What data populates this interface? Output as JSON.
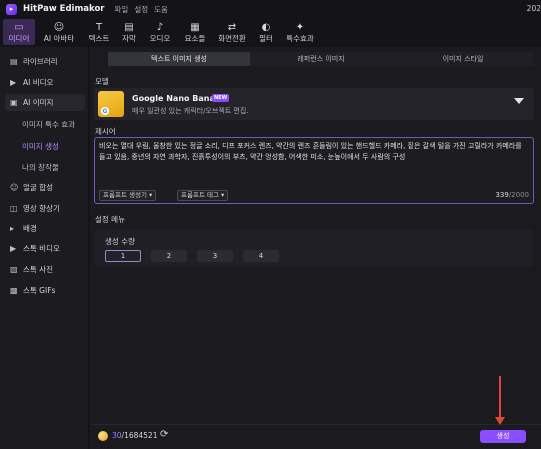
{
  "titlebar": {
    "app_name": "HitPaw Edimakor",
    "menu": [
      "파일",
      "설정",
      "도움"
    ],
    "version": "202"
  },
  "toolbar": [
    {
      "icon": "media-icon",
      "glyph": "▭",
      "label": "미디어",
      "active": true
    },
    {
      "icon": "ai-avatar-icon",
      "glyph": "☺",
      "label": "AI 아바타",
      "active": false
    },
    {
      "icon": "text-icon",
      "glyph": "T",
      "label": "텍스트",
      "active": false
    },
    {
      "icon": "subtitle-icon",
      "glyph": "▤",
      "label": "자막",
      "active": false
    },
    {
      "icon": "audio-icon",
      "glyph": "♪",
      "label": "오디오",
      "active": false
    },
    {
      "icon": "elements-icon",
      "glyph": "▦",
      "label": "요소들",
      "active": false
    },
    {
      "icon": "transition-icon",
      "glyph": "⇄",
      "label": "화면전환",
      "active": false
    },
    {
      "icon": "filter-icon",
      "glyph": "◐",
      "label": "필터",
      "active": false
    },
    {
      "icon": "effects-icon",
      "glyph": "✦",
      "label": "특수효과",
      "active": false
    }
  ],
  "sidebar": {
    "items": [
      {
        "icon": "library-icon",
        "glyph": "▤",
        "label": "라이브러리"
      },
      {
        "icon": "ai-video-icon",
        "glyph": "▶",
        "label": "AI 비디오"
      },
      {
        "icon": "ai-image-icon",
        "glyph": "▣",
        "label": "AI 이미지"
      },
      {
        "icon": "face-swap-icon",
        "glyph": "☺",
        "label": "얼굴 합성"
      },
      {
        "icon": "video-enhance-icon",
        "glyph": "◫",
        "label": "영상 향상기"
      },
      {
        "icon": "background-icon",
        "glyph": "▸",
        "label": "배경"
      },
      {
        "icon": "stock-video-icon",
        "glyph": "▶",
        "label": "스톡 비디오"
      },
      {
        "icon": "stock-photo-icon",
        "glyph": "▨",
        "label": "스톡 사진"
      },
      {
        "icon": "stock-gif-icon",
        "glyph": "▩",
        "label": "스톡 GIFs"
      }
    ],
    "sub_items": [
      "이미지 특수 효과",
      "이미지 생성",
      "나의 창작물"
    ]
  },
  "tabs": [
    "텍스트 이미지 생성",
    "레퍼런스 이미지",
    "이미지 스타일"
  ],
  "model": {
    "section_label": "모델",
    "name": "Google Nano Banana",
    "badge": "NEW",
    "description": "매우 일관성 있는 캐릭터/오브젝트 편집."
  },
  "prompt": {
    "section_label": "제시어",
    "text": "비오는 열대 우림, 울창한 있는 정글 소리, 디프 포커스 렌즈, 약간의 렌즈 흔들림이 있는 핸드헬드 카메라, 짙은 갈색 털을 가진 고릴라가 카메라를 들고 있음, 중년의 자연 과학자, 진흙투성이의 부츠, 약간 엉성함, 어색한 미소, 눈높이에서 두 사람의 구성",
    "generator_button": "프롬프트 생성기",
    "tag_button": "프롬프트 태그",
    "count": "339",
    "max": "/2000"
  },
  "settings": {
    "section_label": "설정 메뉴",
    "count_label": "생성 수량",
    "counts": [
      "1",
      "2",
      "3",
      "4"
    ]
  },
  "footer": {
    "credits_used": "30",
    "credits_total": "/1684521",
    "generate_button": "생성"
  },
  "colors": {
    "accent": "#8a4dff",
    "annotation_arrow": "#e0443a"
  }
}
